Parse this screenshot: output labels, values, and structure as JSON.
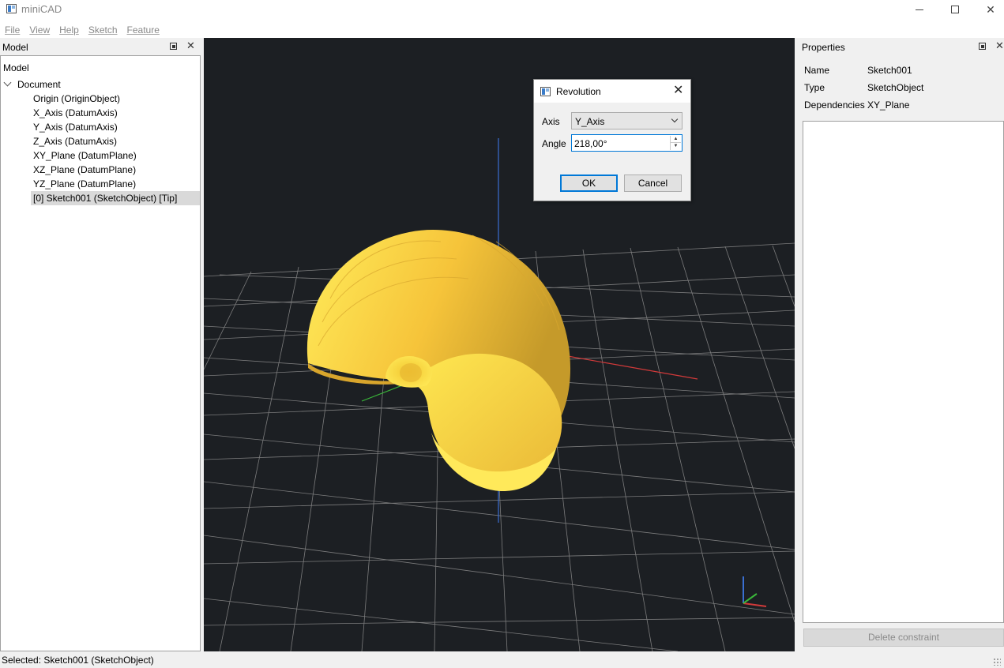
{
  "window": {
    "title": "miniCAD",
    "minimize_icon": "minimize-icon",
    "maximize_icon": "maximize-icon",
    "close_glyph": "✕"
  },
  "menu": [
    "File",
    "View",
    "Help",
    "Sketch",
    "Feature"
  ],
  "model_panel": {
    "title": "Model",
    "close_glyph": "✕",
    "tree_header": "Model",
    "root": "Document",
    "items": [
      "Origin (OriginObject)",
      "X_Axis (DatumAxis)",
      "Y_Axis (DatumAxis)",
      "Z_Axis (DatumAxis)",
      "XY_Plane (DatumPlane)",
      "XZ_Plane (DatumPlane)",
      "YZ_Plane (DatumPlane)",
      "[0] Sketch001 (SketchObject) [Tip]"
    ],
    "selected_index": 7
  },
  "properties_panel": {
    "title": "Properties",
    "close_glyph": "✕",
    "rows": [
      {
        "key": "Name",
        "value": "Sketch001"
      },
      {
        "key": "Type",
        "value": "SketchObject"
      },
      {
        "key": "Dependencies",
        "value": "XY_Plane"
      }
    ],
    "delete_button": "Delete constraint"
  },
  "status": {
    "text": "Selected: Sketch001 (SketchObject)"
  },
  "dialog": {
    "title": "Revolution",
    "close_glyph": "✕",
    "axis_label": "Axis",
    "axis_value": "Y_Axis",
    "angle_label": "Angle",
    "angle_value": "218,00°",
    "spin_up": "▲",
    "spin_down": "▼",
    "ok": "OK",
    "cancel": "Cancel"
  },
  "colors": {
    "viewport_bg": "#1c1f23",
    "grid": "#8c8c8c",
    "axis_x": "#d23a3a",
    "axis_y": "#3a6fd2",
    "axis_z": "#3ab83a",
    "solid": "#f7c23a"
  }
}
